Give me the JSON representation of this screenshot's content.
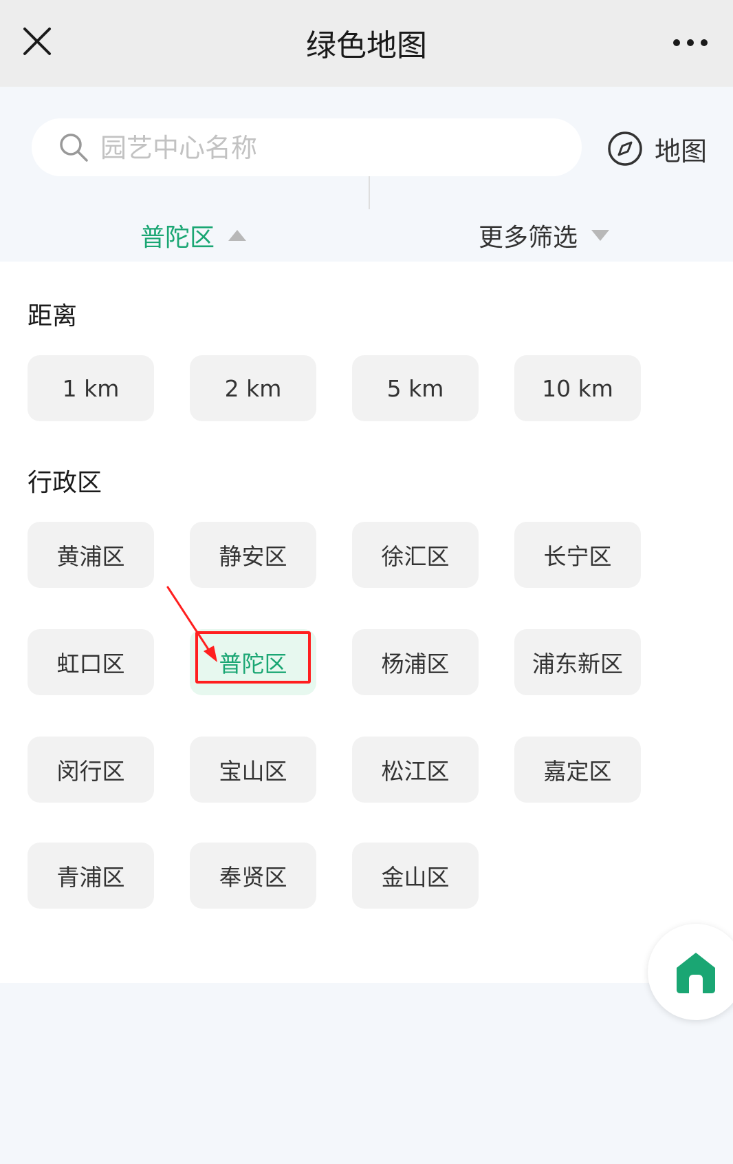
{
  "header": {
    "title": "绿色地图"
  },
  "search": {
    "placeholder": "园艺中心名称",
    "map_label": "地图"
  },
  "filters": {
    "district_tab": "普陀区",
    "more_tab": "更多筛选"
  },
  "distance": {
    "title": "距离",
    "options": [
      "1 km",
      "2 km",
      "5 km",
      "10 km"
    ]
  },
  "districts": {
    "title": "行政区",
    "options": [
      "黄浦区",
      "静安区",
      "徐汇区",
      "长宁区",
      "虹口区",
      "普陀区",
      "杨浦区",
      "浦东新区",
      "闵行区",
      "宝山区",
      "松江区",
      "嘉定区",
      "青浦区",
      "奉贤区",
      "金山区"
    ],
    "selected": "普陀区"
  },
  "colors": {
    "accent": "#1aa673",
    "highlight": "#ff1f1f",
    "home_icon": "#1aa673"
  },
  "icons": {
    "close": "close-icon",
    "more": "more-icon",
    "search": "search-icon",
    "map": "compass-icon",
    "home": "home-icon"
  }
}
